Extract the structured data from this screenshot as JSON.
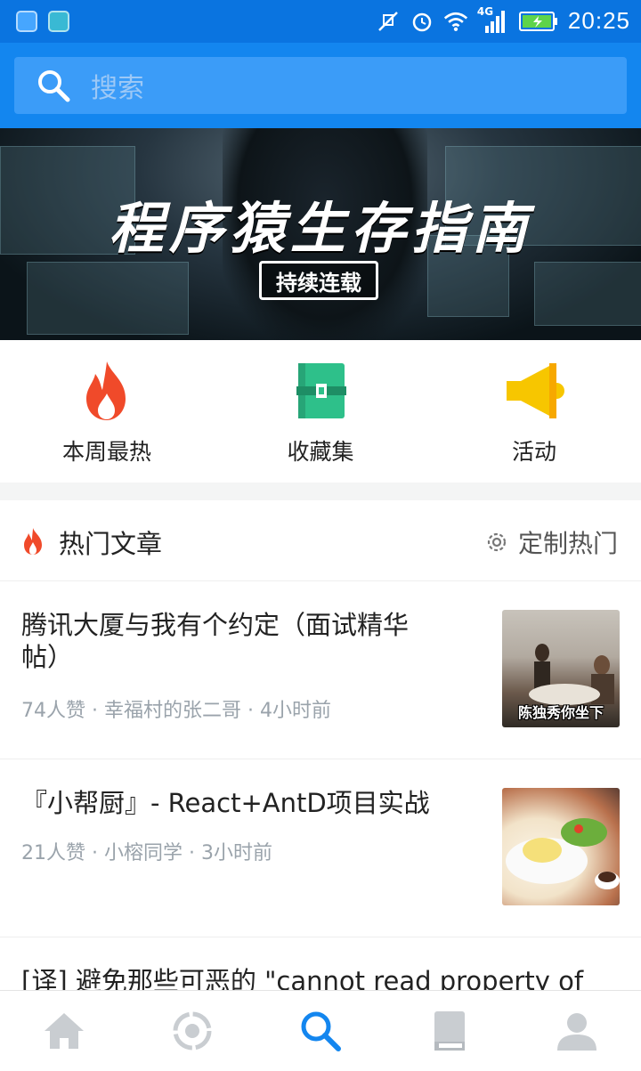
{
  "status_bar": {
    "time": "20:25",
    "network": "4G"
  },
  "search": {
    "placeholder": "搜索"
  },
  "banner": {
    "title": "程序猿生存指南",
    "badge": "持续连载"
  },
  "quick_entries": [
    {
      "label": "本周最热",
      "icon": "fire-icon"
    },
    {
      "label": "收藏集",
      "icon": "collection-icon"
    },
    {
      "label": "活动",
      "icon": "megaphone-icon"
    }
  ],
  "hot_section": {
    "title": "热门文章",
    "customize_label": "定制热门"
  },
  "articles": [
    {
      "title": "腾讯大厦与我有个约定（面试精华帖）",
      "meta": "74人赞 · 幸福村的张二哥 · 4小时前",
      "thumb_caption": "陈独秀你坐下"
    },
    {
      "title": "『小帮厨』- React+AntD项目实战",
      "meta": "21人赞 · 小榕同学 · 3小时前"
    },
    {
      "title": "[译] 避免那些可恶的 \"cannot read property of"
    }
  ],
  "tabs": [
    {
      "icon": "home-icon"
    },
    {
      "icon": "explore-icon"
    },
    {
      "icon": "search-icon",
      "active": true
    },
    {
      "icon": "book-icon"
    },
    {
      "icon": "profile-icon"
    }
  ],
  "colors": {
    "brand": "#1386ef",
    "status_bar": "#0a74e0",
    "active_tab": "#1386ef",
    "inactive_tab": "#c9cdd1"
  }
}
